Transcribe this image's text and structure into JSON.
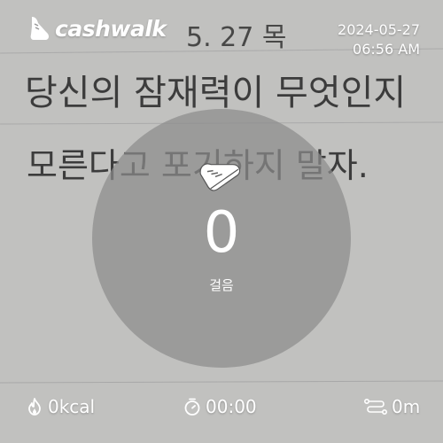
{
  "app": {
    "logo_text": "cashwalk"
  },
  "datetime": {
    "date": "2024-05-27",
    "time": "06:56 AM"
  },
  "steps": {
    "value": "0",
    "label": "걸음"
  },
  "stats": {
    "calories": "0kcal",
    "duration": "00:00",
    "distance": "0m"
  },
  "background": {
    "lines": [
      "5. 27 목",
      "당신의 잠재력이 무엇인지",
      "모른다고 포기하지 말자."
    ]
  }
}
